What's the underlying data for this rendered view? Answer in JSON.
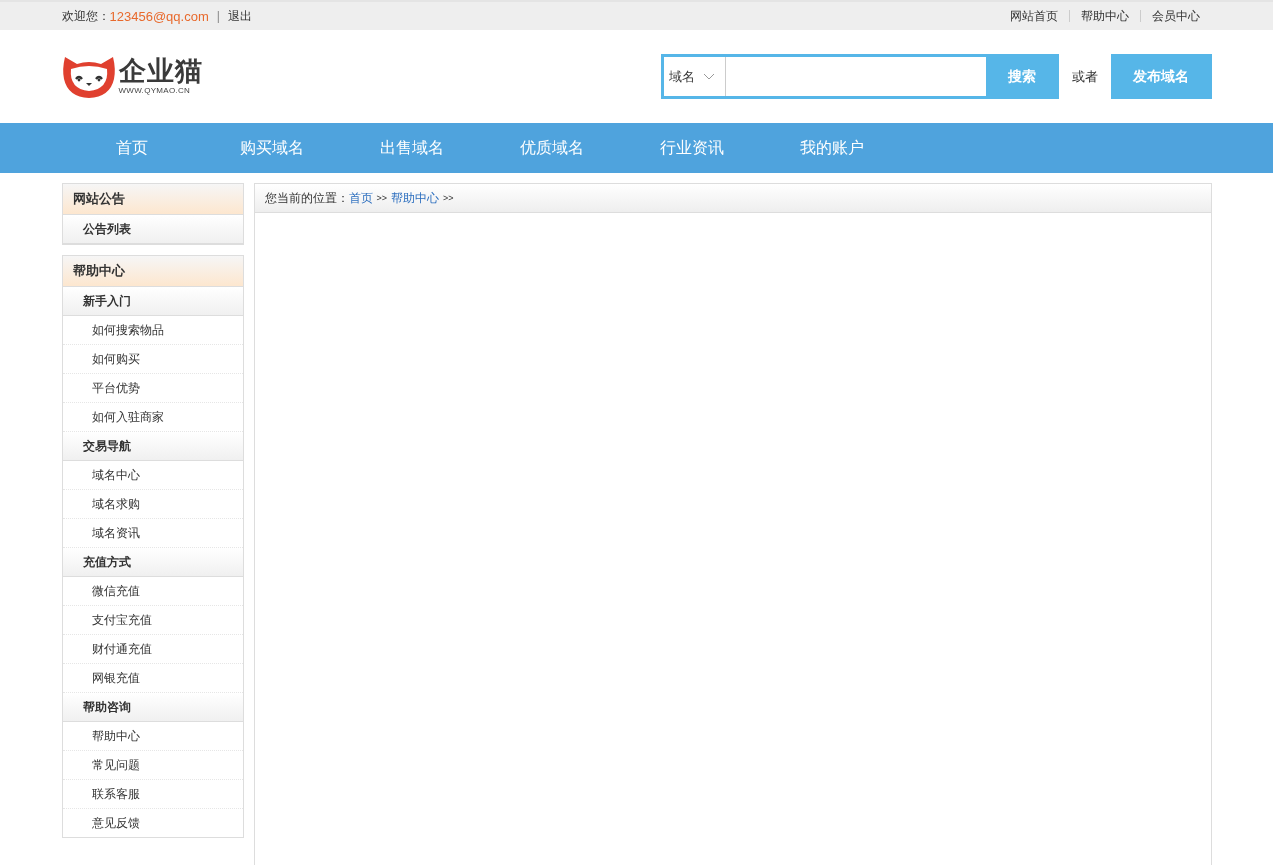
{
  "top_bar": {
    "welcome": "欢迎您：",
    "user": "123456@qq.com",
    "separator": "|",
    "logout": "退出",
    "links": [
      "网站首页",
      "帮助中心",
      "会员中心"
    ]
  },
  "logo": {
    "name": "企业猫",
    "url": "WWW.QYMAO.CN"
  },
  "search": {
    "scope": "域名",
    "button": "搜索"
  },
  "or_text": "或者",
  "publish_button": "发布域名",
  "nav": [
    "首页",
    "购买域名",
    "出售域名",
    "优质域名",
    "行业资讯",
    "我的账户"
  ],
  "sidebar": [
    {
      "title": "网站公告",
      "children": [
        {
          "label": "公告列表"
        }
      ]
    },
    {
      "title": "帮助中心",
      "children": [
        {
          "label": "新手入门",
          "children": [
            {
              "label": "如何搜索物品"
            },
            {
              "label": "如何购买"
            },
            {
              "label": "平台优势"
            },
            {
              "label": "如何入驻商家"
            }
          ]
        },
        {
          "label": "交易导航",
          "children": [
            {
              "label": "域名中心"
            },
            {
              "label": "域名求购"
            },
            {
              "label": "域名资讯"
            }
          ]
        },
        {
          "label": "充值方式",
          "children": [
            {
              "label": "微信充值"
            },
            {
              "label": "支付宝充值"
            },
            {
              "label": "财付通充值"
            },
            {
              "label": "网银充值"
            }
          ]
        },
        {
          "label": "帮助咨询",
          "children": [
            {
              "label": "帮助中心"
            },
            {
              "label": "常见问题"
            },
            {
              "label": "联系客服"
            },
            {
              "label": "意见反馈"
            }
          ]
        }
      ]
    }
  ],
  "breadcrumb": [
    {
      "kind": "text",
      "text": "您当前的位置："
    },
    {
      "kind": "link",
      "text": "首页"
    },
    {
      "kind": "separator",
      "text": ">>"
    },
    {
      "kind": "link",
      "text": "帮助中心"
    },
    {
      "kind": "separator",
      "text": ">>"
    }
  ]
}
